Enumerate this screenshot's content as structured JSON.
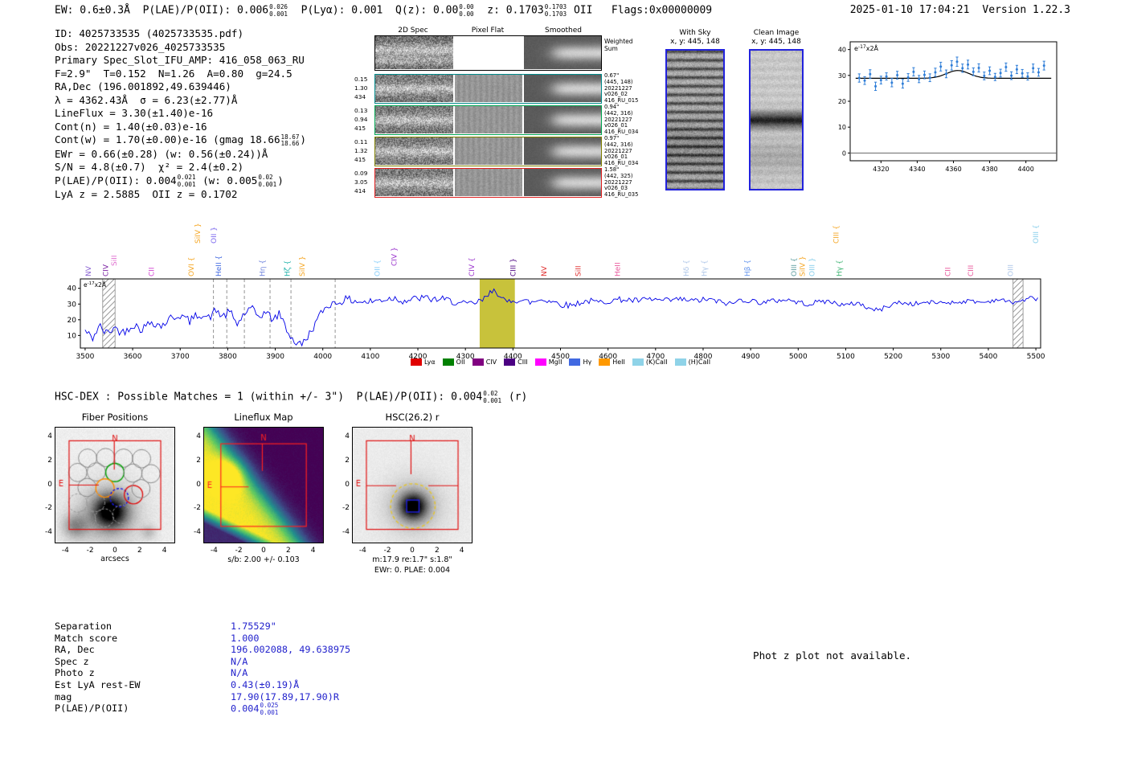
{
  "meta": {
    "timestamp": "2025-01-10 17:04:21",
    "version": "Version 1.22.3"
  },
  "header": {
    "segments": [
      {
        "t": "EW: 0.6±0.3Å  P(LAE)/P(OII): 0.006"
      },
      {
        "sup": "0.026",
        "sub": "0.001"
      },
      {
        "t": "  P(Lyα): 0.001  Q(z): 0.00"
      },
      {
        "sup": "0.00",
        "sub": "0.00"
      },
      {
        "t": "  z: 0.1703"
      },
      {
        "sup": "0.1703",
        "sub": "0.1703"
      },
      {
        "t": " OII   Flags:0x00000009"
      }
    ]
  },
  "info_block": {
    "lines": [
      [
        {
          "t": "ID: 4025733535 (4025733535.pdf)"
        }
      ],
      [
        {
          "t": "Obs: 20221227v026_4025733535"
        }
      ],
      [
        {
          "t": "Primary Spec_Slot_IFU_AMP: 416_058_063_RU"
        }
      ],
      [
        {
          "t": "F=2.9\"  T=0.152  N=1.26  A=0.80  g=24.5"
        }
      ],
      [
        {
          "t": "RA,Dec (196.001892,49.639446)"
        }
      ],
      [
        {
          "t": "λ = 4362.43Å  σ = 6.23(±2.77)Å"
        }
      ],
      [
        {
          "t": "LineFlux = 3.30(±1.40)e-16"
        }
      ],
      [
        {
          "t": "Cont(n) = 1.40(±0.03)e-16"
        }
      ],
      [
        {
          "t": "Cont(w) = 1.70(±0.00)e-16 (gmag 18.66"
        },
        {
          "sup": "18.67",
          "sub": "18.66"
        },
        {
          "t": ")"
        }
      ],
      [
        {
          "t": "EWr = 0.66(±0.28) (w: 0.56(±0.24))Å"
        }
      ],
      [
        {
          "t": "S/N = 4.8(±0.7)  χ² = 2.4(±0.2)"
        }
      ],
      [
        {
          "t": "P(LAE)/P(OII): 0.004"
        },
        {
          "sup": "0.021",
          "sub": "0.001"
        },
        {
          "t": " (w: 0.005"
        },
        {
          "sup": "0.02",
          "sub": "0.001"
        },
        {
          "t": ")"
        }
      ],
      [
        {
          "t": "LyA z = 2.5885  OII z = 0.1702"
        }
      ]
    ]
  },
  "spec2d": {
    "col_headers": [
      "2D Spec",
      "Pixel Flat",
      "Smoothed"
    ],
    "weighted_label": [
      "Weighted",
      "Sum"
    ],
    "rows": [
      {
        "weighted": true,
        "color": "#000000",
        "left": [],
        "right": []
      },
      {
        "weighted": false,
        "color": "#008b8b",
        "left": [
          "0.15",
          "1.30",
          "434"
        ],
        "right": [
          "0.67\"",
          "(445, 148)",
          "20221227",
          "v026_02",
          "416_RU_015"
        ]
      },
      {
        "weighted": false,
        "color": "#00a651",
        "left": [
          "0.13",
          "0.94",
          "415"
        ],
        "right": [
          "0.94\"",
          "(442, 316)",
          "20221227",
          "v026_01",
          "416_RU_034"
        ]
      },
      {
        "weighted": false,
        "color": "#808000",
        "left": [
          "0.11",
          "1.32",
          "415"
        ],
        "right": [
          "0.97\"",
          "(442, 316)",
          "20221227",
          "v026_01",
          "416_RU_034"
        ]
      },
      {
        "weighted": false,
        "color": "#e02020",
        "left": [
          "0.09",
          "3.05",
          "414"
        ],
        "right": [
          "1.58\"",
          "(442, 325)",
          "20221227",
          "v026_03",
          "416_RU_035"
        ]
      }
    ]
  },
  "cutouts2d": {
    "with_sky": {
      "title": "With Sky",
      "coords": "x, y: 445, 148"
    },
    "clean": {
      "title": "Clean Image",
      "coords": "x, y: 445, 148"
    }
  },
  "hsc_line": {
    "segments": [
      {
        "t": "HSC-DEX : Possible Matches = 1 (within +/- 3\")  P(LAE)/P(OII): 0.004"
      },
      {
        "sup": "0.02",
        "sub": "0.001"
      },
      {
        "t": " (r)"
      }
    ]
  },
  "cutouts": {
    "fiber_positions": {
      "title": "Fiber Positions",
      "xlabel": "arcsecs",
      "ticks": [
        -4,
        -2,
        0,
        2,
        4
      ],
      "compass": {
        "n": "N",
        "e": "E"
      },
      "fibers": [
        [
          -2.2,
          2.25,
          "gray"
        ],
        [
          -0.75,
          2.3,
          "gray"
        ],
        [
          0.7,
          2.25,
          "gray"
        ],
        [
          2.15,
          2.2,
          "gray"
        ],
        [
          -3.0,
          1.05,
          "gray"
        ],
        [
          -1.5,
          1.1,
          "gray"
        ],
        [
          0.0,
          1.05,
          "green"
        ],
        [
          1.45,
          1.0,
          "gray"
        ],
        [
          2.9,
          0.95,
          "gray"
        ],
        [
          -2.25,
          -0.2,
          "gray"
        ],
        [
          -0.8,
          -0.25,
          "orange"
        ],
        [
          0.35,
          -1.05,
          "blue-dash"
        ],
        [
          1.5,
          -0.8,
          "red"
        ],
        [
          2.1,
          -0.3,
          "gray"
        ],
        [
          -3.0,
          -1.5,
          "gray-dash"
        ],
        [
          -1.55,
          -1.45,
          "gray-dash"
        ],
        [
          -2.3,
          -2.8,
          "gray-dash"
        ],
        [
          -0.85,
          -2.75,
          "gray-dash"
        ],
        [
          0.55,
          -2.45,
          "gray-dash"
        ]
      ]
    },
    "lineflux": {
      "title": "Lineflux Map",
      "subtitle": "s/b: 2.00 +/- 0.103",
      "ticks": [
        -4,
        -2,
        0,
        2,
        4
      ],
      "compass": {
        "n": "N",
        "e": "E"
      }
    },
    "hsc": {
      "title": "HSC(26.2) r",
      "subtitle1": "m:17.9 re:1.7\" s:1.8\"",
      "subtitle2": "EWr: 0. PLAE: 0.004",
      "ticks": [
        -4,
        -2,
        0,
        2,
        4
      ],
      "compass": {
        "n": "N",
        "e": "E"
      },
      "aperture_arcsec": 1.8
    }
  },
  "match_table": {
    "rows": [
      {
        "label": "Separation",
        "value": "1.75529\""
      },
      {
        "label": "Match score",
        "value": "1.000"
      },
      {
        "label": "RA, Dec",
        "value": "196.002088, 49.638975"
      },
      {
        "label": "Spec z",
        "value": "N/A"
      },
      {
        "label": "Photo z",
        "value": "N/A"
      },
      {
        "label": "Est LyA rest-EW",
        "value": "0.43(±0.19)Å"
      },
      {
        "label": "mag",
        "value": "17.90(17.89,17.90)R"
      },
      {
        "label": "P(LAE)/P(OII)",
        "value": "0.004",
        "sup": "0.025",
        "sub": "0.001"
      }
    ]
  },
  "photz_note": "Phot z plot not available.",
  "chart_data": [
    {
      "id": "emission-line-fit",
      "type": "scatter",
      "xlim": [
        4303,
        4417
      ],
      "ylim": [
        -3,
        43
      ],
      "xticks": [
        4320,
        4340,
        4360,
        4380,
        4400
      ],
      "yticks": [
        0,
        10,
        20,
        30,
        40
      ],
      "annotation": {
        "base": "e",
        "sup": "-17",
        "rest": "x2Å"
      },
      "point_color": "#2f7ed8",
      "fit": {
        "center": 4362.43,
        "sigma": 6.23,
        "amplitude": 3.0,
        "baseline": 28.9
      },
      "points": [
        [
          4308,
          29.0,
          1.6
        ],
        [
          4311,
          28.0,
          1.5
        ],
        [
          4314,
          30.5,
          1.7
        ],
        [
          4317,
          25.8,
          1.6
        ],
        [
          4320,
          28.2,
          1.5
        ],
        [
          4323,
          29.6,
          1.4
        ],
        [
          4326,
          27.2,
          1.6
        ],
        [
          4329,
          30.1,
          1.5
        ],
        [
          4332,
          26.8,
          1.7
        ],
        [
          4335,
          29.2,
          1.5
        ],
        [
          4338,
          31.4,
          1.6
        ],
        [
          4341,
          28.6,
          1.4
        ],
        [
          4344,
          30.2,
          1.5
        ],
        [
          4347,
          29.1,
          1.5
        ],
        [
          4350,
          31.2,
          1.6
        ],
        [
          4353,
          33.4,
          1.7
        ],
        [
          4356,
          30.6,
          1.5
        ],
        [
          4359,
          33.9,
          1.8
        ],
        [
          4362,
          35.3,
          1.8
        ],
        [
          4365,
          32.8,
          1.6
        ],
        [
          4368,
          34.2,
          1.7
        ],
        [
          4371,
          31.4,
          1.5
        ],
        [
          4374,
          32.9,
          1.6
        ],
        [
          4377,
          29.8,
          1.5
        ],
        [
          4380,
          31.8,
          1.5
        ],
        [
          4383,
          29.4,
          1.4
        ],
        [
          4386,
          30.9,
          1.5
        ],
        [
          4389,
          33.2,
          1.6
        ],
        [
          4392,
          29.9,
          1.5
        ],
        [
          4395,
          32.3,
          1.6
        ],
        [
          4398,
          30.8,
          1.5
        ],
        [
          4401,
          29.6,
          1.4
        ],
        [
          4404,
          32.8,
          1.6
        ],
        [
          4407,
          31.2,
          1.5
        ],
        [
          4410,
          33.8,
          1.7
        ]
      ]
    },
    {
      "id": "full-spectrum",
      "type": "line",
      "color": "#0000e8",
      "xlim": [
        3490,
        5510
      ],
      "ylim": [
        2,
        46
      ],
      "xticks": [
        3500,
        3600,
        3700,
        3800,
        3900,
        4000,
        4100,
        4200,
        4300,
        4400,
        4500,
        4600,
        4700,
        4800,
        4900,
        5000,
        5100,
        5200,
        5300,
        5400,
        5500
      ],
      "yticks": [
        10,
        20,
        30,
        40
      ],
      "annotation": {
        "base": "e",
        "sup": "-17",
        "rest": "x2Å"
      },
      "highlight_band": {
        "x0": 4330,
        "x1": 4404,
        "color": "#c2bb26"
      },
      "hatch_bands": [
        [
          3537,
          3563
        ],
        [
          5452,
          5473
        ]
      ],
      "dashed_lines": [
        3770,
        3798,
        3835,
        3889,
        3933,
        4026
      ],
      "noise": {
        "sigma_blue": 3.0,
        "sigma_red": 1.2,
        "seed": 42
      },
      "anchors": [
        [
          3500,
          13
        ],
        [
          3515,
          8
        ],
        [
          3530,
          16
        ],
        [
          3545,
          11
        ],
        [
          3560,
          15
        ],
        [
          3580,
          12
        ],
        [
          3600,
          17
        ],
        [
          3620,
          14
        ],
        [
          3640,
          19
        ],
        [
          3660,
          16
        ],
        [
          3680,
          21
        ],
        [
          3700,
          23
        ],
        [
          3720,
          19
        ],
        [
          3740,
          24
        ],
        [
          3760,
          21
        ],
        [
          3775,
          26
        ],
        [
          3790,
          22
        ],
        [
          3805,
          25
        ],
        [
          3820,
          17
        ],
        [
          3835,
          24
        ],
        [
          3850,
          27
        ],
        [
          3865,
          22
        ],
        [
          3880,
          25
        ],
        [
          3895,
          20
        ],
        [
          3910,
          24
        ],
        [
          3925,
          13
        ],
        [
          3940,
          6
        ],
        [
          3955,
          4
        ],
        [
          3970,
          10
        ],
        [
          3985,
          18
        ],
        [
          4000,
          26
        ],
        [
          4015,
          30
        ],
        [
          4030,
          31
        ],
        [
          4050,
          33
        ],
        [
          4070,
          32
        ],
        [
          4090,
          31
        ],
        [
          4110,
          32
        ],
        [
          4130,
          33
        ],
        [
          4150,
          34
        ],
        [
          4170,
          32
        ],
        [
          4190,
          33
        ],
        [
          4210,
          34
        ],
        [
          4230,
          33
        ],
        [
          4250,
          33
        ],
        [
          4270,
          32
        ],
        [
          4290,
          30
        ],
        [
          4310,
          30
        ],
        [
          4325,
          31
        ],
        [
          4340,
          33
        ],
        [
          4352,
          37
        ],
        [
          4362,
          41
        ],
        [
          4372,
          34
        ],
        [
          4385,
          31
        ],
        [
          4400,
          33
        ],
        [
          4420,
          32
        ],
        [
          4440,
          31
        ],
        [
          4460,
          33
        ],
        [
          4480,
          32
        ],
        [
          4500,
          30
        ],
        [
          4520,
          29
        ],
        [
          4540,
          31
        ],
        [
          4560,
          32
        ],
        [
          4580,
          31
        ],
        [
          4600,
          32
        ],
        [
          4630,
          33
        ],
        [
          4660,
          32
        ],
        [
          4690,
          33
        ],
        [
          4720,
          32
        ],
        [
          4750,
          33
        ],
        [
          4780,
          32
        ],
        [
          4810,
          33
        ],
        [
          4840,
          31
        ],
        [
          4860,
          30
        ],
        [
          4880,
          33
        ],
        [
          4900,
          32
        ],
        [
          4925,
          31
        ],
        [
          4950,
          32
        ],
        [
          4975,
          33
        ],
        [
          5000,
          31
        ],
        [
          5025,
          30
        ],
        [
          5050,
          32
        ],
        [
          5075,
          31
        ],
        [
          5100,
          29
        ],
        [
          5125,
          31
        ],
        [
          5150,
          27
        ],
        [
          5170,
          26
        ],
        [
          5190,
          29
        ],
        [
          5210,
          31
        ],
        [
          5240,
          30
        ],
        [
          5270,
          31
        ],
        [
          5300,
          31
        ],
        [
          5330,
          31
        ],
        [
          5360,
          32
        ],
        [
          5390,
          31
        ],
        [
          5420,
          33
        ],
        [
          5450,
          31
        ],
        [
          5470,
          32
        ],
        [
          5490,
          34
        ],
        [
          5505,
          33
        ]
      ],
      "labels": [
        [
          3512,
          "NV",
          "#8a63d2",
          2
        ],
        [
          3548,
          "CIV",
          "#7a1fa2",
          2
        ],
        [
          3566,
          "SiII",
          "#e06fd0",
          1
        ],
        [
          3645,
          "CII",
          "#d040d0",
          2
        ],
        [
          3728,
          "OVI {",
          "#f5a623",
          2
        ],
        [
          3742,
          "SiIV }",
          "#f5a623",
          0
        ],
        [
          3776,
          "OII }",
          "#7b68ee",
          0
        ],
        [
          3786,
          "HeII {",
          "#4169e1",
          2
        ],
        [
          3878,
          "Hη {",
          "#6a7fdb",
          2
        ],
        [
          3930,
          "Hζ {",
          "#20b2aa",
          2
        ],
        [
          3962,
          "SiIV }",
          "#f5a623",
          2
        ],
        [
          4120,
          "OII {",
          "#87cefa",
          2
        ],
        [
          4155,
          "CIV }",
          "#9932cc",
          1
        ],
        [
          4318,
          "CIV {",
          "#9932cc",
          2
        ],
        [
          4405,
          "CIII }",
          "#4b0082",
          2
        ],
        [
          4470,
          "NV",
          "#e03030",
          2
        ],
        [
          4542,
          "SiII",
          "#e03030",
          2
        ],
        [
          4625,
          "HeII",
          "#e8559a",
          2
        ],
        [
          4770,
          "Hδ {",
          "#aec6e8",
          2
        ],
        [
          4808,
          "Hγ {",
          "#aec6e8",
          2
        ],
        [
          4898,
          "Hβ {",
          "#6495ed",
          2
        ],
        [
          4996,
          "OIII {",
          "#5f9ea0",
          2
        ],
        [
          5014,
          "SiIV }",
          "#f5a623",
          2
        ],
        [
          5034,
          "OIII }",
          "#87ceeb",
          2
        ],
        [
          5085,
          "CIII {",
          "#f5a623",
          0
        ],
        [
          5092,
          "Hγ {",
          "#3cb371",
          2
        ],
        [
          5320,
          "CII",
          "#e8559a",
          2
        ],
        [
          5368,
          "CIII",
          "#e8559a",
          2
        ],
        [
          5452,
          "OIII",
          "#aec6e8",
          2
        ],
        [
          5505,
          "OIII {",
          "#87ceeb",
          0
        ]
      ],
      "legend": [
        {
          "t": "Lyα",
          "c": "#e00000"
        },
        {
          "t": "OII",
          "c": "#008000"
        },
        {
          "t": "CIV",
          "c": "#800080"
        },
        {
          "t": "CIII",
          "c": "#4b0082"
        },
        {
          "t": "MgII",
          "c": "#ff00ff"
        },
        {
          "t": "Hγ",
          "c": "#4169e1"
        },
        {
          "t": "HeII",
          "c": "#ff9900"
        },
        {
          "t": "(K)CaII",
          "c": "#8fd3e8"
        },
        {
          "t": "(H)CaII",
          "c": "#8fd3e8"
        }
      ]
    }
  ]
}
